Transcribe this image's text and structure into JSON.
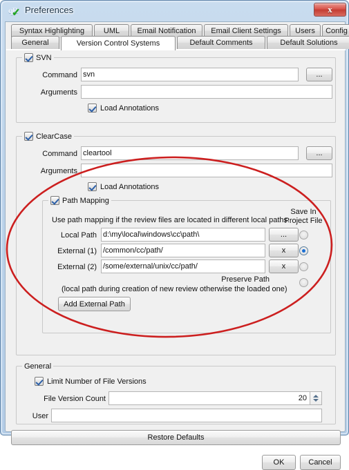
{
  "window": {
    "title": "Preferences",
    "icon": "app-logo-qr-check",
    "close_label": "x"
  },
  "tabs": {
    "row1": [
      {
        "label": "Syntax Highlighting",
        "active": false
      },
      {
        "label": "UML",
        "active": false
      },
      {
        "label": "Email Notification",
        "active": false
      },
      {
        "label": "Email Client Settings",
        "active": false
      },
      {
        "label": "Users",
        "active": false
      },
      {
        "label": "Config",
        "active": false
      }
    ],
    "row2": [
      {
        "label": "General",
        "active": false
      },
      {
        "label": "Version Control Systems",
        "active": true
      },
      {
        "label": "Default Comments",
        "active": false
      },
      {
        "label": "Default Solutions",
        "active": false
      }
    ]
  },
  "svn": {
    "legend": "SVN",
    "enabled": true,
    "command_label": "Command",
    "command_value": "svn",
    "command_browse": "...",
    "arguments_label": "Arguments",
    "arguments_value": "",
    "load_annotations_label": "Load Annotations",
    "load_annotations_checked": true
  },
  "clearcase": {
    "legend": "ClearCase",
    "enabled": true,
    "command_label": "Command",
    "command_value": "cleartool",
    "command_browse": "...",
    "arguments_label": "Arguments",
    "arguments_value": "",
    "load_annotations_label": "Load Annotations",
    "load_annotations_checked": true,
    "path_mapping": {
      "legend": "Path Mapping",
      "enabled": true,
      "hint": "Use path mapping if the review files are located in different local paths.",
      "save_in_header_line1": "Save In",
      "save_in_header_line2": "Project File",
      "rows": [
        {
          "label": "Local Path",
          "value": "d:\\my\\local\\windows\\cc\\path\\",
          "button": "...",
          "selected": false
        },
        {
          "label": "External (1)",
          "value": "/common/cc/path/",
          "button": "x",
          "selected": true
        },
        {
          "label": "External (2)",
          "value": "/some/external/unix/cc/path/",
          "button": "x",
          "selected": false
        }
      ],
      "preserve_path_label": "Preserve Path",
      "preserve_path_selected": false,
      "preserve_path_hint": "(local path during creation of new review otherwise the loaded one)",
      "add_external_button": "Add External Path"
    }
  },
  "general": {
    "legend": "General",
    "limit_versions_label": "Limit Number of File Versions",
    "limit_versions_checked": true,
    "file_version_count_label": "File Version Count",
    "file_version_count_value": "20",
    "user_label": "User",
    "user_value": ""
  },
  "footer": {
    "restore_defaults": "Restore Defaults",
    "ok": "OK",
    "cancel": "Cancel"
  },
  "annotation": {
    "shape": "red-ellipse-highlight",
    "color": "#cc1f1f"
  }
}
